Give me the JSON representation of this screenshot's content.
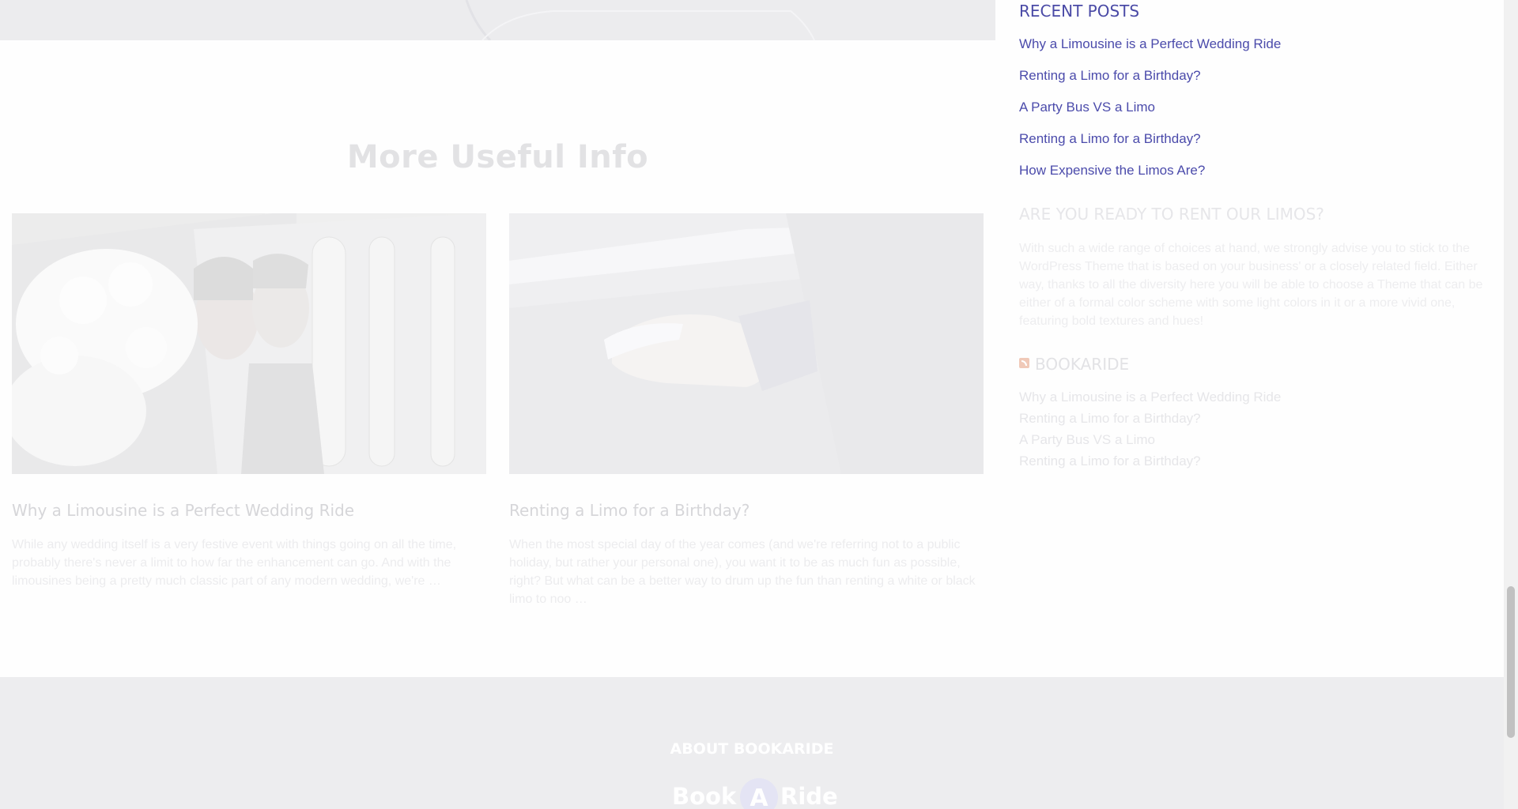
{
  "main": {
    "section_title": "More Useful Info",
    "cards": [
      {
        "title": "Why a Limousine is a Perfect Wedding Ride",
        "excerpt": "While any wedding itself is a very festive event with things going on all the time, probably there's never a limit to how far the enhancement can go. And with the limousines being a pretty much classic part of any modern wedding, we're …",
        "image": "wedding-couple-in-limo"
      },
      {
        "title": "Renting a Limo for a Birthday?",
        "excerpt": "When the most special day of the year comes (and we're referring not to a public holiday, but rather your personal one), you want it to be as much fun as possible, right? But what can be a better way to drum up the fun than renting a white or black limo to noo …",
        "image": "hand-on-limo-door-handle"
      }
    ]
  },
  "sidebar": {
    "recent_posts": {
      "title": "RECENT POSTS",
      "items": [
        "Why a Limousine is a Perfect Wedding Ride",
        "Renting a Limo for a Birthday?",
        "A Party Bus VS a Limo",
        "Renting a Limo for a Birthday?",
        "How Expensive the Limos Are?"
      ]
    },
    "ready": {
      "title": "ARE YOU READY TO RENT OUR LIMOS?",
      "text": "With such a wide range of choices at hand, we strongly advise you to stick to the WordPress Theme that is based on your business' or a closely related field. Either way, thanks to all the diversity here you will be able to choose a Theme that can be either of a formal color scheme with some light colors in it or a more vivid one, featuring bold textures and hues!"
    },
    "rss": {
      "icon": "rss-icon",
      "title": "BOOKARIDE",
      "items": [
        "Why a Limousine is a Perfect Wedding Ride",
        "Renting a Limo for a Birthday?",
        "A Party Bus VS a Limo",
        "Renting a Limo for a Birthday?"
      ]
    }
  },
  "footer": {
    "title": "ABOUT BOOKARIDE",
    "logo": {
      "word1": "Book",
      "badge": "A",
      "word2": "Ride"
    }
  },
  "colors": {
    "link": "#4b4bab",
    "footer_bg": "#ededef",
    "faded_text": "#e6e6e9"
  }
}
